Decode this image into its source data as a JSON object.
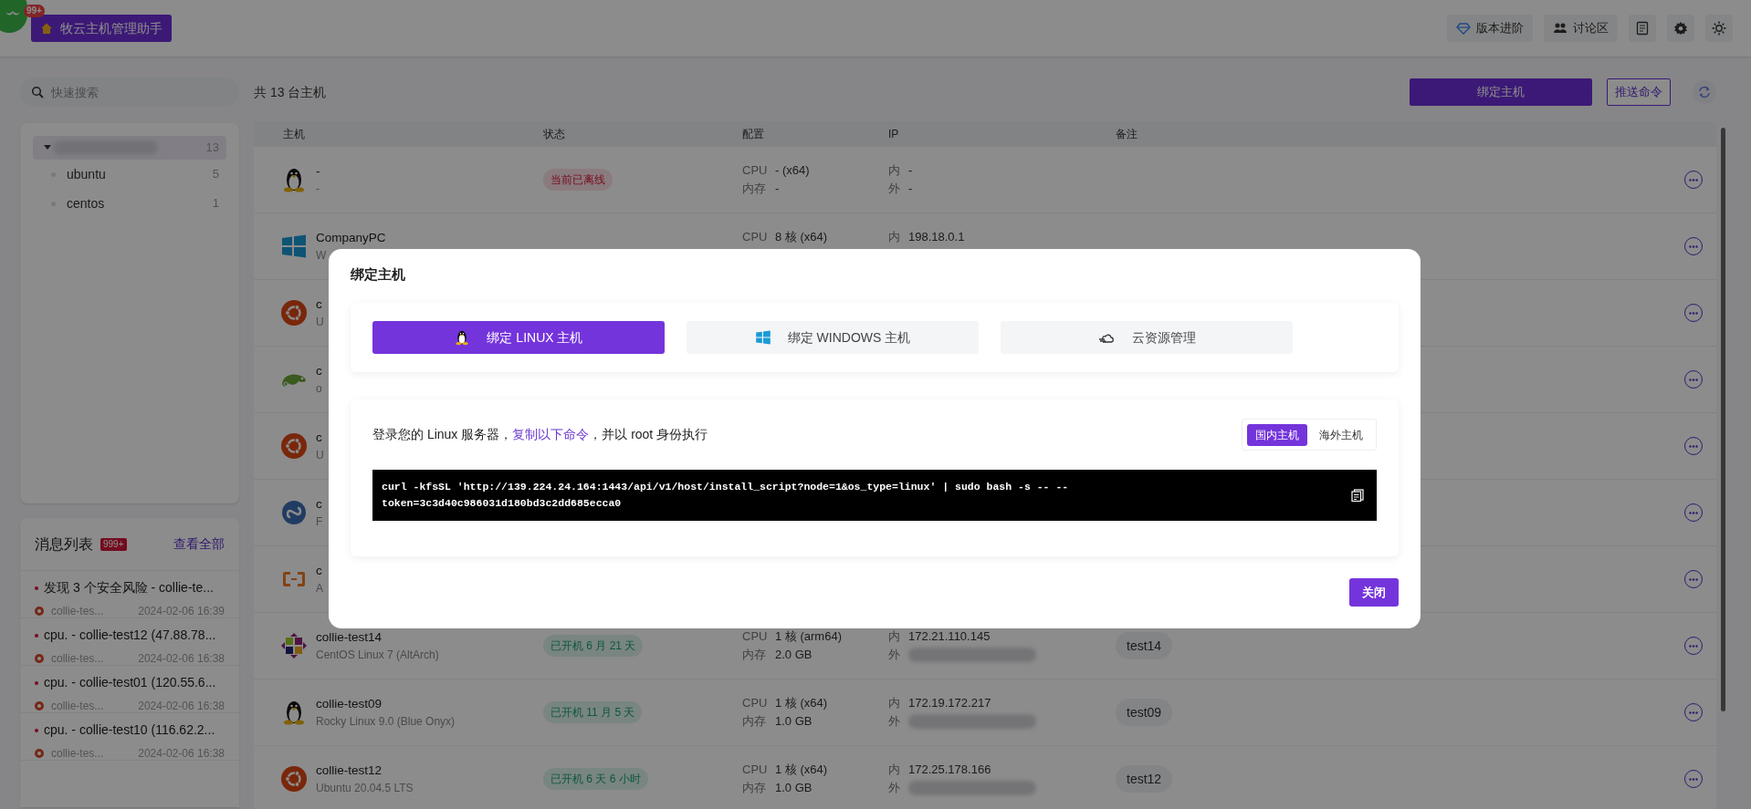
{
  "app": {
    "badge": "99+",
    "title": "牧云主机管理助手"
  },
  "header_links": [
    {
      "kind": "diamond",
      "label": "版本进阶"
    },
    {
      "kind": "people",
      "label": "讨论区"
    }
  ],
  "header_icons": [
    {
      "kind": "doc"
    },
    {
      "kind": "gear"
    },
    {
      "kind": "sun"
    }
  ],
  "search": {
    "placeholder": "快速搜索"
  },
  "host_groups": [
    {
      "count": "13",
      "selected": true,
      "name_redacted": true,
      "children": [
        {
          "name": "ubuntu",
          "count": "5",
          "selected": false
        },
        {
          "name": "centos",
          "count": "1",
          "selected": false
        }
      ]
    }
  ],
  "messages": {
    "title": "消息列表",
    "badge": "999+",
    "view_all": "查看全部",
    "items": [
      {
        "title": "发现 3 个安全风险 - collie-te...",
        "host": "collie-tes...",
        "time": "2024-02-06 16:39"
      },
      {
        "title": "cpu. - collie-test12 (47.88.78...",
        "host": "collie-tes...",
        "time": "2024-02-06 16:38"
      },
      {
        "title": "cpu. - collie-test01 (120.55.6...",
        "host": "collie-tes...",
        "time": "2024-02-06 16:38"
      },
      {
        "title": "cpu. - collie-test10 (116.62.2...",
        "host": "collie-tes...",
        "time": "2024-02-06 16:38"
      }
    ]
  },
  "host_count": "共 13 台主机",
  "actions": {
    "bind": "绑定主机",
    "push": "推送命令"
  },
  "table": {
    "columns": [
      "主机",
      "状态",
      "配置",
      "IP",
      "备注"
    ],
    "rows": [
      {
        "kind": "penguin",
        "name": "-",
        "os": "-",
        "status": {
          "kind": "offline",
          "label": "当前已离线"
        },
        "cpu_label": "CPU",
        "cpu": "- (x64)",
        "mem_label": "内存",
        "mem": "-",
        "ip_in_label": "内",
        "ip_in": "-",
        "ip_out_label": "外",
        "ip_out": "-"
      },
      {
        "kind": "windows",
        "name": "CompanyPC",
        "os": "W",
        "cpu_label": "CPU",
        "cpu": "8 核 (x64)",
        "ip_in_label": "内",
        "ip_in": "198.18.0.1"
      },
      {
        "kind": "ubuntu",
        "name": "c",
        "os": "U"
      },
      {
        "kind": "chameleon",
        "name": "c",
        "os": "o"
      },
      {
        "kind": "ubuntu",
        "name": "c",
        "os": "U"
      },
      {
        "kind": "fedora",
        "name": "c",
        "os": "F"
      },
      {
        "kind": "aliyun",
        "name": "c",
        "os": "A"
      },
      {
        "kind": "centos",
        "name": "collie-test14",
        "os": "CentOS Linux 7 (AltArch)",
        "status": {
          "kind": "online",
          "label": "已开机 6 月 21 天"
        },
        "cpu_label": "CPU",
        "cpu": "1 核 (arm64)",
        "mem_label": "内存",
        "mem": "2.0 GB",
        "ip_in_label": "内",
        "ip_in": "172.21.110.145",
        "ip_out_label": "外",
        "ip_out_redacted": true,
        "remark": "test14"
      },
      {
        "kind": "penguin",
        "name": "collie-test09",
        "os": "Rocky Linux 9.0 (Blue Onyx)",
        "status": {
          "kind": "online",
          "label": "已开机 11 月 5 天"
        },
        "cpu_label": "CPU",
        "cpu": "1 核 (x64)",
        "mem_label": "内存",
        "mem": "1.0 GB",
        "ip_in_label": "内",
        "ip_in": "172.19.172.217",
        "ip_out_label": "外",
        "ip_out_redacted": true,
        "remark": "test09"
      },
      {
        "kind": "ubuntu",
        "name": "collie-test12",
        "os": "Ubuntu 20.04.5 LTS",
        "status": {
          "kind": "online",
          "label": "已开机 6 天 6 小时"
        },
        "cpu_label": "CPU",
        "cpu": "1 核 (x64)",
        "mem_label": "内存",
        "mem": "1.0 GB",
        "ip_in_label": "内",
        "ip_in": "172.25.178.166",
        "ip_out_label": "外",
        "ip_out_redacted": true,
        "remark": "test12"
      }
    ]
  },
  "modal": {
    "title": "绑定主机",
    "tabs": [
      {
        "kind": "penguin",
        "label": "绑定 LINUX 主机",
        "selected": true
      },
      {
        "kind": "windows",
        "label": "绑定 WINDOWS 主机",
        "selected": false
      },
      {
        "kind": "cloud",
        "label": "云资源管理",
        "selected": false
      }
    ],
    "instruction": {
      "before": "登录您的 Linux 服务器，",
      "link": "复制以下命令",
      "after": "，并以 root 身份执行"
    },
    "regions": [
      {
        "label": "国内主机",
        "selected": true
      },
      {
        "label": "海外主机",
        "selected": false
      }
    ],
    "command_lines": [
      "curl -kfsSL 'http://139.224.24.164:1443/api/v1/host/install_script?node=1&os_type=linux' | sudo bash -s -- --",
      "token=3c3d40c986031d180bd3c2dd685ecca0"
    ],
    "close": "关闭"
  }
}
